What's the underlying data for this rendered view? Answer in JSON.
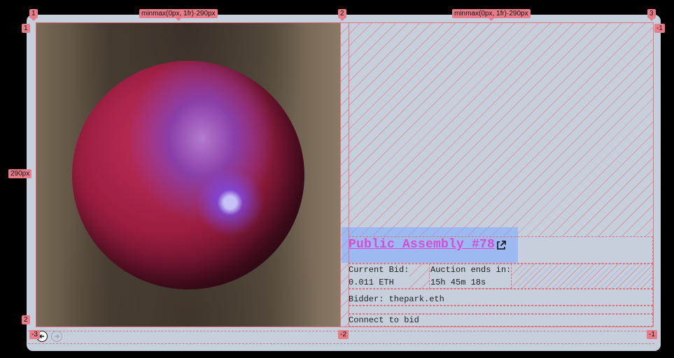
{
  "grid_overlay": {
    "column_numbers": [
      "1",
      "2",
      "3"
    ],
    "row_numbers": [
      "1",
      "2"
    ],
    "negative_column_numbers": [
      "-3",
      "-2",
      "-1"
    ],
    "negative_row_number": "-1",
    "column_track_labels": [
      "minmax(0px, 1fr)·290px",
      "minmax(0px, 1fr)·290px"
    ],
    "row_track_label": "290px",
    "overlay_color": "#e87c88",
    "area_highlight_color": "#82aaff"
  },
  "auction": {
    "title": "Public Assembly #78",
    "current_bid_label": "Current Bid:",
    "current_bid_value": "0.011 ETH",
    "ends_label": "Auction ends in:",
    "ends_value": "15h 45m 18s",
    "bidder_text": "Bidder: thepark.eth",
    "connect_text": "Connect to bid",
    "title_color": "#d84bd8"
  },
  "nav": {
    "prev_icon": "arrow-left-circle-icon",
    "next_icon": "arrow-right-circle-icon"
  },
  "icons": {
    "external_link": "external-link-icon"
  }
}
